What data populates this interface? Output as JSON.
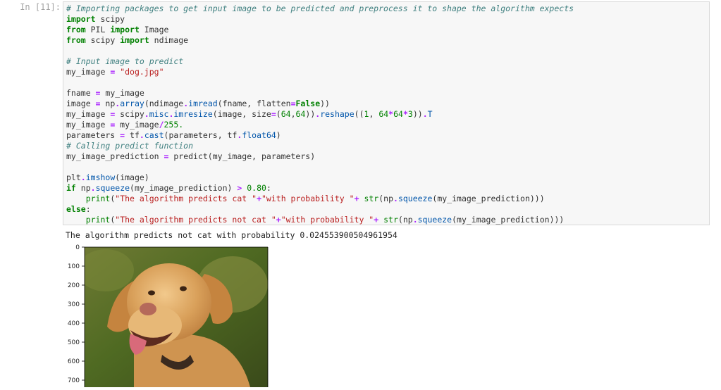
{
  "cell": {
    "prompt": "In [11]:",
    "code_lines": [
      [
        {
          "t": "cm",
          "v": "# Importing packages to get input image to be predicted and preprocess it to shape the algorithm expects"
        }
      ],
      [
        {
          "t": "kw",
          "v": "import"
        },
        {
          "t": "",
          "v": " scipy"
        }
      ],
      [
        {
          "t": "kw",
          "v": "from"
        },
        {
          "t": "",
          "v": " PIL "
        },
        {
          "t": "kw",
          "v": "import"
        },
        {
          "t": "",
          "v": " Image"
        }
      ],
      [
        {
          "t": "kw",
          "v": "from"
        },
        {
          "t": "",
          "v": " scipy "
        },
        {
          "t": "kw",
          "v": "import"
        },
        {
          "t": "",
          "v": " ndimage"
        }
      ],
      [],
      [
        {
          "t": "cm",
          "v": "# Input image to predict"
        }
      ],
      [
        {
          "t": "",
          "v": "my_image "
        },
        {
          "t": "op",
          "v": "="
        },
        {
          "t": "",
          "v": " "
        },
        {
          "t": "st",
          "v": "\"dog.jpg\""
        }
      ],
      [],
      [
        {
          "t": "",
          "v": "fname "
        },
        {
          "t": "op",
          "v": "="
        },
        {
          "t": "",
          "v": " my_image"
        }
      ],
      [
        {
          "t": "",
          "v": "image "
        },
        {
          "t": "op",
          "v": "="
        },
        {
          "t": "",
          "v": " np"
        },
        {
          "t": "op",
          "v": "."
        },
        {
          "t": "at",
          "v": "array"
        },
        {
          "t": "",
          "v": "(ndimage"
        },
        {
          "t": "op",
          "v": "."
        },
        {
          "t": "at",
          "v": "imread"
        },
        {
          "t": "",
          "v": "(fname, flatten"
        },
        {
          "t": "op",
          "v": "="
        },
        {
          "t": "kw",
          "v": "False"
        },
        {
          "t": "",
          "v": "))"
        }
      ],
      [
        {
          "t": "",
          "v": "my_image "
        },
        {
          "t": "op",
          "v": "="
        },
        {
          "t": "",
          "v": " scipy"
        },
        {
          "t": "op",
          "v": "."
        },
        {
          "t": "at",
          "v": "misc"
        },
        {
          "t": "op",
          "v": "."
        },
        {
          "t": "at",
          "v": "imresize"
        },
        {
          "t": "",
          "v": "(image, size"
        },
        {
          "t": "op",
          "v": "="
        },
        {
          "t": "",
          "v": "("
        },
        {
          "t": "nu",
          "v": "64"
        },
        {
          "t": "",
          "v": ","
        },
        {
          "t": "nu",
          "v": "64"
        },
        {
          "t": "",
          "v": "))"
        },
        {
          "t": "op",
          "v": "."
        },
        {
          "t": "at",
          "v": "reshape"
        },
        {
          "t": "",
          "v": "(("
        },
        {
          "t": "nu",
          "v": "1"
        },
        {
          "t": "",
          "v": ", "
        },
        {
          "t": "nu",
          "v": "64"
        },
        {
          "t": "op",
          "v": "*"
        },
        {
          "t": "nu",
          "v": "64"
        },
        {
          "t": "op",
          "v": "*"
        },
        {
          "t": "nu",
          "v": "3"
        },
        {
          "t": "",
          "v": "))"
        },
        {
          "t": "op",
          "v": "."
        },
        {
          "t": "at",
          "v": "T"
        }
      ],
      [
        {
          "t": "",
          "v": "my_image "
        },
        {
          "t": "op",
          "v": "="
        },
        {
          "t": "",
          "v": " my_image"
        },
        {
          "t": "op",
          "v": "/"
        },
        {
          "t": "nu",
          "v": "255."
        }
      ],
      [
        {
          "t": "",
          "v": "parameters "
        },
        {
          "t": "op",
          "v": "="
        },
        {
          "t": "",
          "v": " tf"
        },
        {
          "t": "op",
          "v": "."
        },
        {
          "t": "at",
          "v": "cast"
        },
        {
          "t": "",
          "v": "(parameters, tf"
        },
        {
          "t": "op",
          "v": "."
        },
        {
          "t": "at",
          "v": "float64"
        },
        {
          "t": "",
          "v": ")"
        }
      ],
      [
        {
          "t": "cm",
          "v": "# Calling predict function"
        }
      ],
      [
        {
          "t": "",
          "v": "my_image_prediction "
        },
        {
          "t": "op",
          "v": "="
        },
        {
          "t": "",
          "v": " predict(my_image, parameters)"
        }
      ],
      [],
      [
        {
          "t": "",
          "v": "plt"
        },
        {
          "t": "op",
          "v": "."
        },
        {
          "t": "at",
          "v": "imshow"
        },
        {
          "t": "",
          "v": "(image)"
        }
      ],
      [
        {
          "t": "kw",
          "v": "if"
        },
        {
          "t": "",
          "v": " np"
        },
        {
          "t": "op",
          "v": "."
        },
        {
          "t": "at",
          "v": "squeeze"
        },
        {
          "t": "",
          "v": "(my_image_prediction) "
        },
        {
          "t": "op",
          "v": ">"
        },
        {
          "t": "",
          "v": " "
        },
        {
          "t": "nu",
          "v": "0.80"
        },
        {
          "t": "",
          "v": ":"
        }
      ],
      [
        {
          "t": "",
          "v": "    "
        },
        {
          "t": "nb",
          "v": "print"
        },
        {
          "t": "",
          "v": "("
        },
        {
          "t": "st",
          "v": "\"The algorithm predicts cat \""
        },
        {
          "t": "op",
          "v": "+"
        },
        {
          "t": "st",
          "v": "\"with probability \""
        },
        {
          "t": "op",
          "v": "+"
        },
        {
          "t": "",
          "v": " "
        },
        {
          "t": "nb",
          "v": "str"
        },
        {
          "t": "",
          "v": "(np"
        },
        {
          "t": "op",
          "v": "."
        },
        {
          "t": "at",
          "v": "squeeze"
        },
        {
          "t": "",
          "v": "(my_image_prediction)))"
        }
      ],
      [
        {
          "t": "kw",
          "v": "else"
        },
        {
          "t": "",
          "v": ":"
        }
      ],
      [
        {
          "t": "",
          "v": "    "
        },
        {
          "t": "nb",
          "v": "print"
        },
        {
          "t": "",
          "v": "("
        },
        {
          "t": "st",
          "v": "\"The algorithm predicts not cat \""
        },
        {
          "t": "op",
          "v": "+"
        },
        {
          "t": "st",
          "v": "\"with probability \""
        },
        {
          "t": "op",
          "v": "+"
        },
        {
          "t": "",
          "v": " "
        },
        {
          "t": "nb",
          "v": "str"
        },
        {
          "t": "",
          "v": "(np"
        },
        {
          "t": "op",
          "v": "."
        },
        {
          "t": "at",
          "v": "squeeze"
        },
        {
          "t": "",
          "v": "(my_image_prediction)))"
        }
      ]
    ],
    "output_text": "The algorithm predicts not cat with probability 0.024553900504961954"
  },
  "plot": {
    "y_ticks": [
      "0",
      "100",
      "200",
      "300",
      "400",
      "500",
      "600",
      "700"
    ],
    "image_description_icon": "dog-photo"
  },
  "colors": {
    "cell_background": "#f7f7f7",
    "cell_border": "#d9d9d9",
    "prompt": "#a3a3a3",
    "comment": "#408080",
    "keyword": "#008000",
    "string": "#ba2121"
  }
}
